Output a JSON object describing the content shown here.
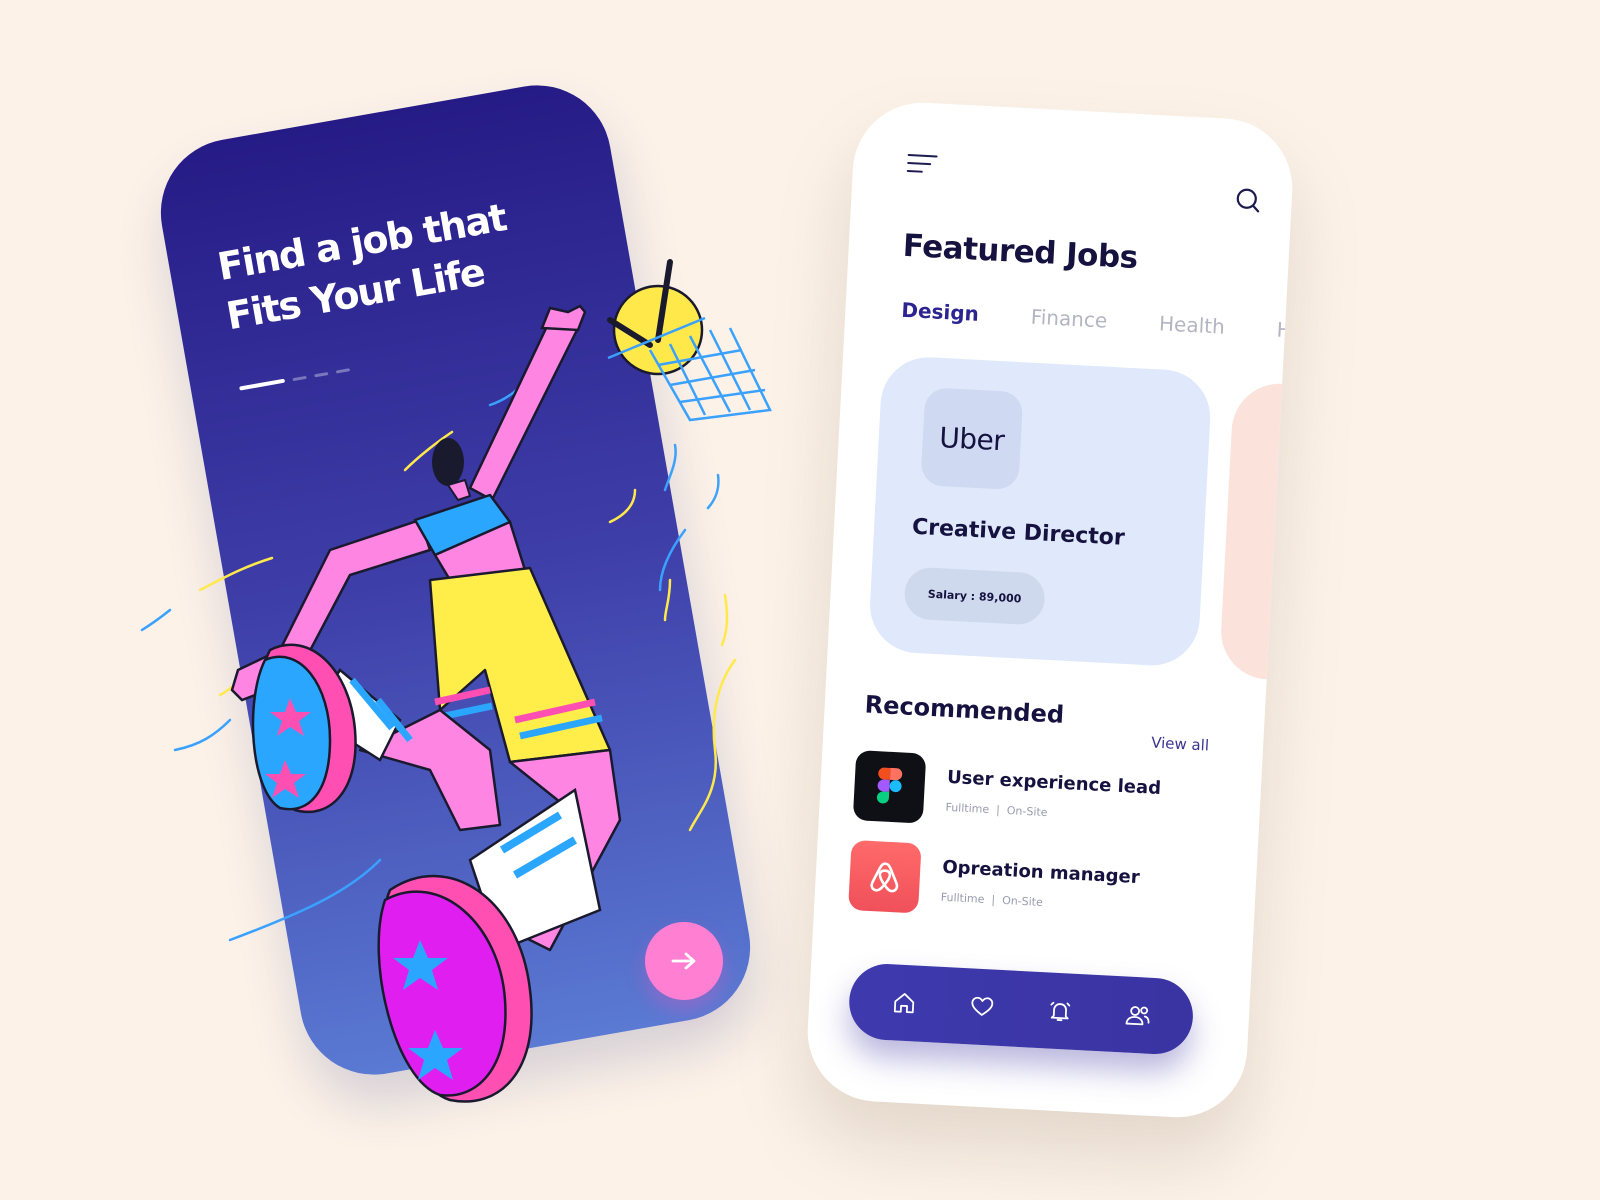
{
  "onboarding": {
    "headline_line1": "Find a job that",
    "headline_line2": "Fits Your Life",
    "progress_current_step": 1,
    "progress_total_steps": 4,
    "next_icon": "arrow-right-icon"
  },
  "jobs_screen": {
    "menu_icon": "menu-icon",
    "search_icon": "search-icon",
    "featured_title": "Featured Jobs",
    "tabs": [
      {
        "label": "Design",
        "active": true
      },
      {
        "label": "Finance",
        "active": false
      },
      {
        "label": "Health",
        "active": false
      },
      {
        "label": "Hote",
        "active": false
      }
    ],
    "featured_card": {
      "company": "Uber",
      "title": "Creative Director",
      "salary": "Salary : 89,000"
    },
    "recommended_title": "Recommended",
    "view_all_label": "View all",
    "recommended": [
      {
        "logo_icon": "figma-icon",
        "title": "User experience lead",
        "type": "Fulltime",
        "separator": "|",
        "location": "On-Site"
      },
      {
        "logo_icon": "airbnb-icon",
        "title": "Opreation manager",
        "type": "Fulltime",
        "separator": "|",
        "location": "On-Site"
      }
    ],
    "bottom_nav": [
      {
        "icon": "home-icon"
      },
      {
        "icon": "heart-icon"
      },
      {
        "icon": "bell-icon"
      },
      {
        "icon": "users-icon"
      }
    ]
  },
  "colors": {
    "background": "#fcf2e8",
    "onboarding_gradient_top": "#261b86",
    "onboarding_gradient_bottom": "#5a7ad3",
    "accent_pink": "#ff7fd3",
    "nav_blue": "#3e3aae",
    "card_blue": "#dfe9fb",
    "text_dark": "#15123f"
  }
}
